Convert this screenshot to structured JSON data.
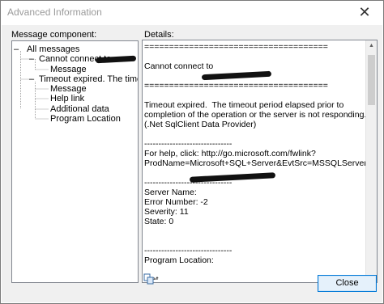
{
  "window": {
    "title": "Advanced Information",
    "close_glyph": "✕"
  },
  "labels": {
    "message_component": "Message component:",
    "details": "Details:"
  },
  "tree": {
    "root": "All messages",
    "node1": "Cannot connect to",
    "node1_children": [
      "Message"
    ],
    "node2": "Timeout expired.  The timeout pe",
    "node2_children": [
      "Message",
      "Help link",
      "Additional data",
      "Program Location"
    ],
    "expand_glyph": "–"
  },
  "details_text": "=====================================\n\nCannot connect to\n\n=====================================\n\nTimeout expired.  The timeout period elapsed prior to completion of the operation or the server is not responding. (.Net SqlClient Data Provider)\n\n-------------------------------\nFor help, click: http://go.microsoft.com/fwlink?ProdName=Microsoft+SQL+Server&EvtSrc=MSSQLServer&EvtID=-2&LinkId=20476\n\n-------------------------------\nServer Name:\nError Number: -2\nSeverity: 11\nState: 0\n\n\n-------------------------------\nProgram Location:\n\n   at System.Data.SqlClient.SqlInternalConnection.OnError(SqlException exception, Boolean breakConnection)\n   at System.Data.SqlClient.TdsParser.ThrowExceptionAndWarning(TdsParserStateObject stateObj)",
  "buttons": {
    "close": "Close"
  },
  "icons": {
    "copy": "copy-icon",
    "scroll_up": "scroll-up-arrow-icon",
    "scroll_down": "scroll-down-arrow-icon"
  }
}
